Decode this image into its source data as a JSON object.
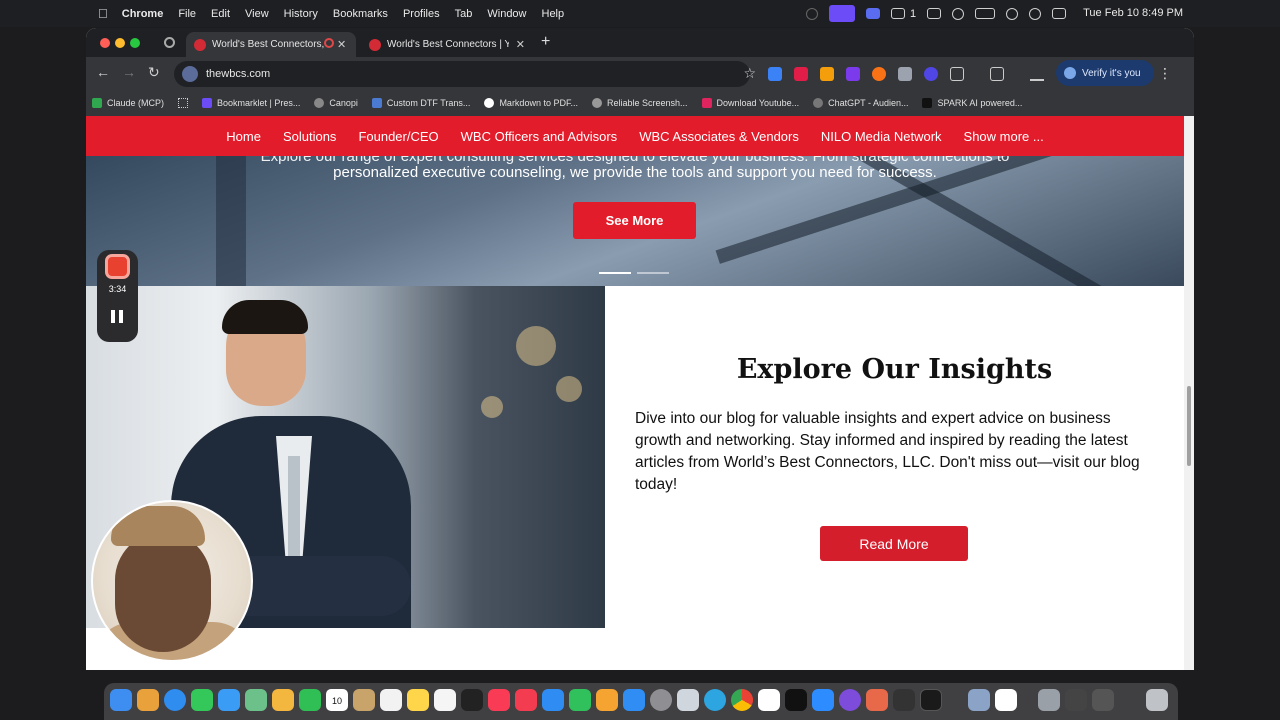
{
  "menubar": {
    "app": "Chrome",
    "items": [
      "File",
      "Edit",
      "View",
      "History",
      "Bookmarks",
      "Profiles",
      "Tab",
      "Window",
      "Help"
    ],
    "status_number": "1",
    "clock": "Tue Feb 10  8:49 PM"
  },
  "tabs": [
    {
      "title": "World's Best Connectors,",
      "active": true
    },
    {
      "title": "World's Best Connectors | Yo",
      "active": false
    }
  ],
  "toolbar": {
    "url": "thewbcs.com",
    "verify_label": "Verify it's you"
  },
  "bookmarks": [
    {
      "label": "Claude (MCP)",
      "color": "#2fa84f"
    },
    {
      "label": "Bookmarklet | Pres...",
      "color": "#6b4cf6"
    },
    {
      "label": "Canopi",
      "color": "#888888"
    },
    {
      "label": "Custom DTF Trans...",
      "color": "#4a7bd0"
    },
    {
      "label": "Markdown to PDF...",
      "color": "#222222"
    },
    {
      "label": "Reliable Screensh...",
      "color": "#999999"
    },
    {
      "label": "Download Youtube...",
      "color": "#e0245e"
    },
    {
      "label": "ChatGPT - Audien...",
      "color": "#777777"
    },
    {
      "label": "SPARK AI powered...",
      "color": "#111111"
    }
  ],
  "site_nav": [
    "Home",
    "Solutions",
    "Founder/CEO",
    "WBC Officers and Advisors",
    "WBC Associates & Vendors",
    "NILO Media Network",
    "Show more ..."
  ],
  "hero": {
    "caption_line1": "Explore our range of expert consulting services designed to elevate your business. From strategic connections to",
    "caption_line2": "personalized executive counseling, we provide the tools and support you need for success.",
    "button": "See More"
  },
  "insights": {
    "title": "Explore Our Insights",
    "body": "Dive into our blog for valuable insights and expert advice on business growth and networking. Stay informed and inspired by reading the latest articles from World’s Best Connectors, LLC. Don't miss out—visit our blog today!",
    "button": "Read More"
  },
  "recorder": {
    "time": "3:34"
  },
  "dock": {
    "calendar_day": "10"
  },
  "colors": {
    "brand_red": "#e21c2b",
    "chrome_dark": "#35363a"
  }
}
